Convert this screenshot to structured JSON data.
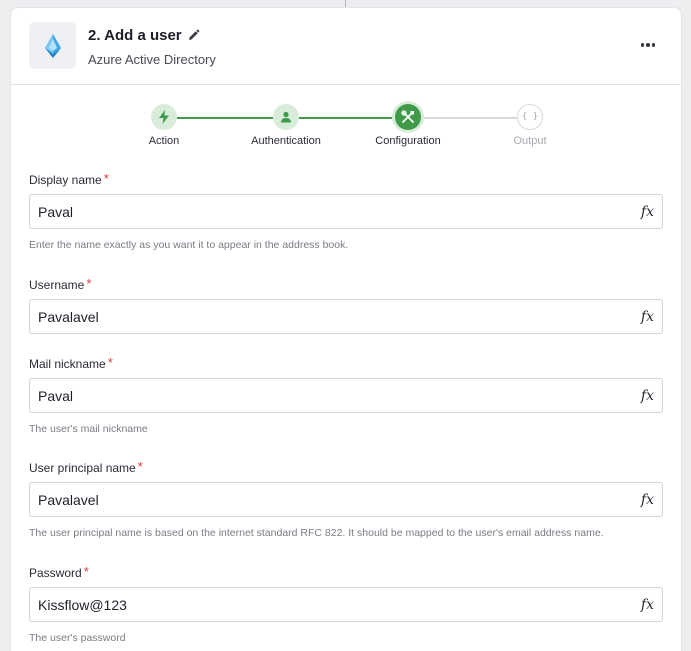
{
  "header": {
    "title": "2. Add a user",
    "subtitle": "Azure Active Directory",
    "app_icon": "azure-ad-icon",
    "edit_icon": "pencil-icon",
    "more_icon": "more-dots-icon"
  },
  "stepper": {
    "steps": [
      {
        "label": "Action",
        "status": "done",
        "icon": "bolt-icon"
      },
      {
        "label": "Authentication",
        "status": "done",
        "icon": "user-icon"
      },
      {
        "label": "Configuration",
        "status": "active",
        "icon": "tools-icon"
      },
      {
        "label": "Output",
        "status": "pending",
        "icon": "braces-icon"
      }
    ]
  },
  "fields": [
    {
      "label": "Display name",
      "value": "Paval",
      "helper": "Enter the name exactly as you want it to appear in the address book."
    },
    {
      "label": "Username",
      "value": "Pavalavel",
      "helper": ""
    },
    {
      "label": "Mail nickname",
      "value": "Paval",
      "helper": "The user's mail nickname"
    },
    {
      "label": "User principal name",
      "value": "Pavalavel",
      "helper": "The user principal name is based on the internet standard RFC 822. It should be mapped to the user's email address name."
    },
    {
      "label": "Password",
      "value": "Kissflow@123",
      "helper": "The user's password"
    }
  ],
  "required_mark": "*",
  "fx_label": "fx",
  "colors": {
    "step_done_bg": "#d7ecd9",
    "step_done_fg": "#3f9a4a",
    "step_active_bg": "#3f9a4a",
    "line_done": "#3f9a4a",
    "line_pending": "#d8d8de",
    "required": "#e03a3a"
  }
}
